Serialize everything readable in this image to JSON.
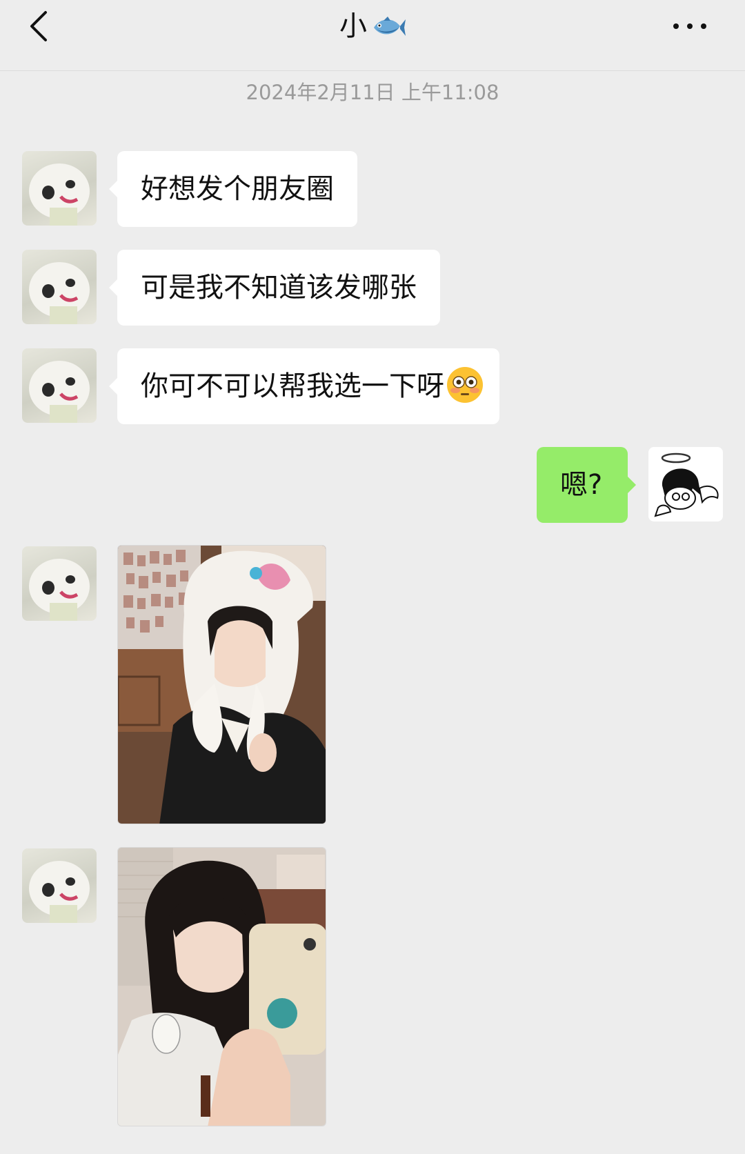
{
  "header": {
    "title": "小",
    "title_emoji": "fish-icon",
    "back_icon": "chevron-left-icon",
    "more_icon": "more-dots-icon"
  },
  "timestamp": "2024年2月11日 上午11:08",
  "messages": [
    {
      "side": "left",
      "type": "text",
      "text": "好想发个朋友圈"
    },
    {
      "side": "left",
      "type": "text",
      "text": "可是我不知道该发哪张"
    },
    {
      "side": "left",
      "type": "text",
      "text": "你可不可以帮我选一下呀",
      "trailing_emoji": "flushed-face-icon"
    },
    {
      "side": "right",
      "type": "text",
      "text": "嗯?"
    },
    {
      "side": "left",
      "type": "image",
      "image": "photo-girl-bunny-hat"
    },
    {
      "side": "left",
      "type": "image",
      "image": "photo-girl-mirror-selfie"
    }
  ],
  "colors": {
    "background": "#ededed",
    "incoming_bubble": "#ffffff",
    "outgoing_bubble": "#95ec69",
    "timestamp_text": "#9a9a9a"
  }
}
